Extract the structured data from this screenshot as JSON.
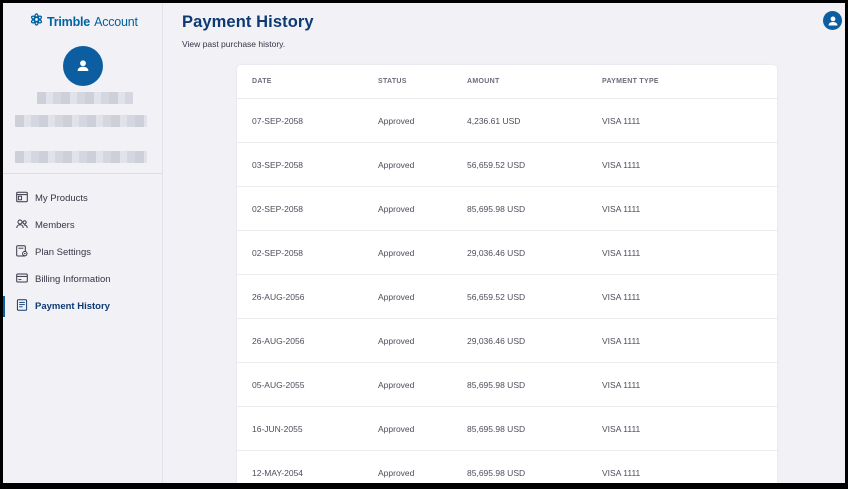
{
  "app": {
    "brand": "Trimble",
    "product": "Account"
  },
  "header": {
    "title": "Payment History",
    "subtitle": "View past purchase history."
  },
  "sidebar": {
    "items": [
      {
        "label": "My Products",
        "icon": "products-icon",
        "active": false
      },
      {
        "label": "Members",
        "icon": "members-icon",
        "active": false
      },
      {
        "label": "Plan Settings",
        "icon": "plan-settings-icon",
        "active": false
      },
      {
        "label": "Billing Information",
        "icon": "billing-icon",
        "active": false
      },
      {
        "label": "Payment History",
        "icon": "payment-history-icon",
        "active": true
      }
    ]
  },
  "table": {
    "columns": [
      "DATE",
      "STATUS",
      "AMOUNT",
      "PAYMENT TYPE"
    ],
    "rows": [
      {
        "date": "07-SEP-2058",
        "status": "Approved",
        "amount": "4,236.61 USD",
        "payment_type": "VISA 1111"
      },
      {
        "date": "03-SEP-2058",
        "status": "Approved",
        "amount": "56,659.52 USD",
        "payment_type": "VISA 1111"
      },
      {
        "date": "02-SEP-2058",
        "status": "Approved",
        "amount": "85,695.98 USD",
        "payment_type": "VISA 1111"
      },
      {
        "date": "02-SEP-2058",
        "status": "Approved",
        "amount": "29,036.46 USD",
        "payment_type": "VISA 1111"
      },
      {
        "date": "26-AUG-2056",
        "status": "Approved",
        "amount": "56,659.52 USD",
        "payment_type": "VISA 1111"
      },
      {
        "date": "26-AUG-2056",
        "status": "Approved",
        "amount": "29,036.46 USD",
        "payment_type": "VISA 1111"
      },
      {
        "date": "05-AUG-2055",
        "status": "Approved",
        "amount": "85,695.98 USD",
        "payment_type": "VISA 1111"
      },
      {
        "date": "16-JUN-2055",
        "status": "Approved",
        "amount": "85,695.98 USD",
        "payment_type": "VISA 1111"
      },
      {
        "date": "12-MAY-2054",
        "status": "Approved",
        "amount": "85,695.98 USD",
        "payment_type": "VISA 1111"
      }
    ]
  },
  "colors": {
    "brand_blue": "#0063a3",
    "title_navy": "#0d3a73",
    "avatar_blue": "#0d5ea1",
    "sidebar_bg": "#f1f1f6"
  }
}
